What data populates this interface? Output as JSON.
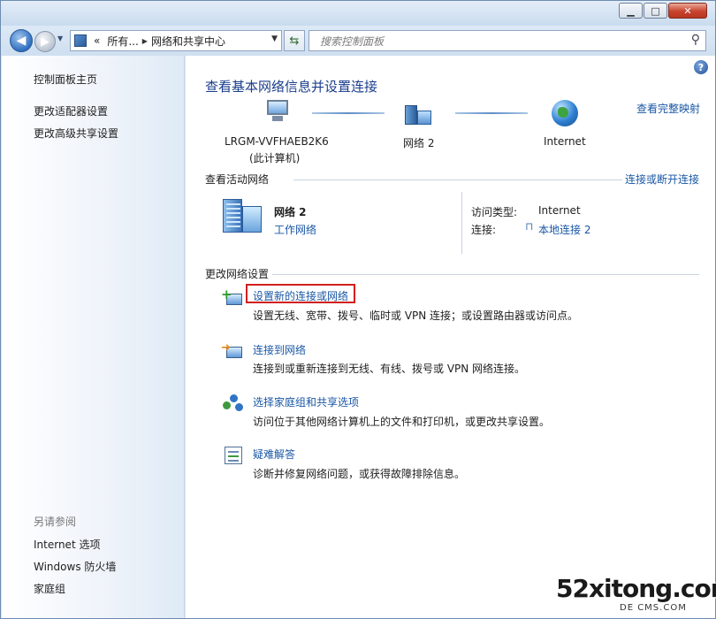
{
  "window": {
    "minimize_glyph": "▁",
    "maximize_glyph": "□",
    "close_glyph": "✕"
  },
  "nav": {
    "address_prefix": "«",
    "crumb1": "所有...",
    "crumb2": "网络和共享中心",
    "search_placeholder": "搜索控制面板"
  },
  "sidebar": {
    "home": "控制面板主页",
    "items": [
      "更改适配器设置",
      "更改高级共享设置"
    ],
    "see_also_heading": "另请参阅",
    "see_also": [
      "Internet 选项",
      "Windows 防火墙",
      "家庭组"
    ]
  },
  "main": {
    "help_glyph": "?",
    "title": "查看基本网络信息并设置连接",
    "full_map_link": "查看完整映射",
    "map": {
      "computer_name": "LRGM-VVFHAEB2K6",
      "computer_sub": "(此计算机)",
      "network_name": "网络  2",
      "internet": "Internet"
    },
    "active_heading": "查看活动网络",
    "connect_disconnect_link": "连接或断开连接",
    "active": {
      "name": "网络  2",
      "type_link": "工作网络",
      "access_label": "访问类型:",
      "access_value": "Internet",
      "connections_label": "连接:",
      "connections_link": "本地连接 2"
    },
    "change_heading": "更改网络设置",
    "tasks": [
      {
        "title": "设置新的连接或网络",
        "desc": "设置无线、宽带、拨号、临时或 VPN 连接；或设置路由器或访问点。"
      },
      {
        "title": "连接到网络",
        "desc": "连接到或重新连接到无线、有线、拨号或 VPN 网络连接。"
      },
      {
        "title": "选择家庭组和共享选项",
        "desc": "访问位于其他网络计算机上的文件和打印机，或更改共享设置。"
      },
      {
        "title": "疑难解答",
        "desc": "诊断并修复网络问题，或获得故障排除信息。"
      }
    ]
  },
  "watermark": {
    "main": "52xitong.com",
    "sub": "DE  CMS.COM"
  }
}
